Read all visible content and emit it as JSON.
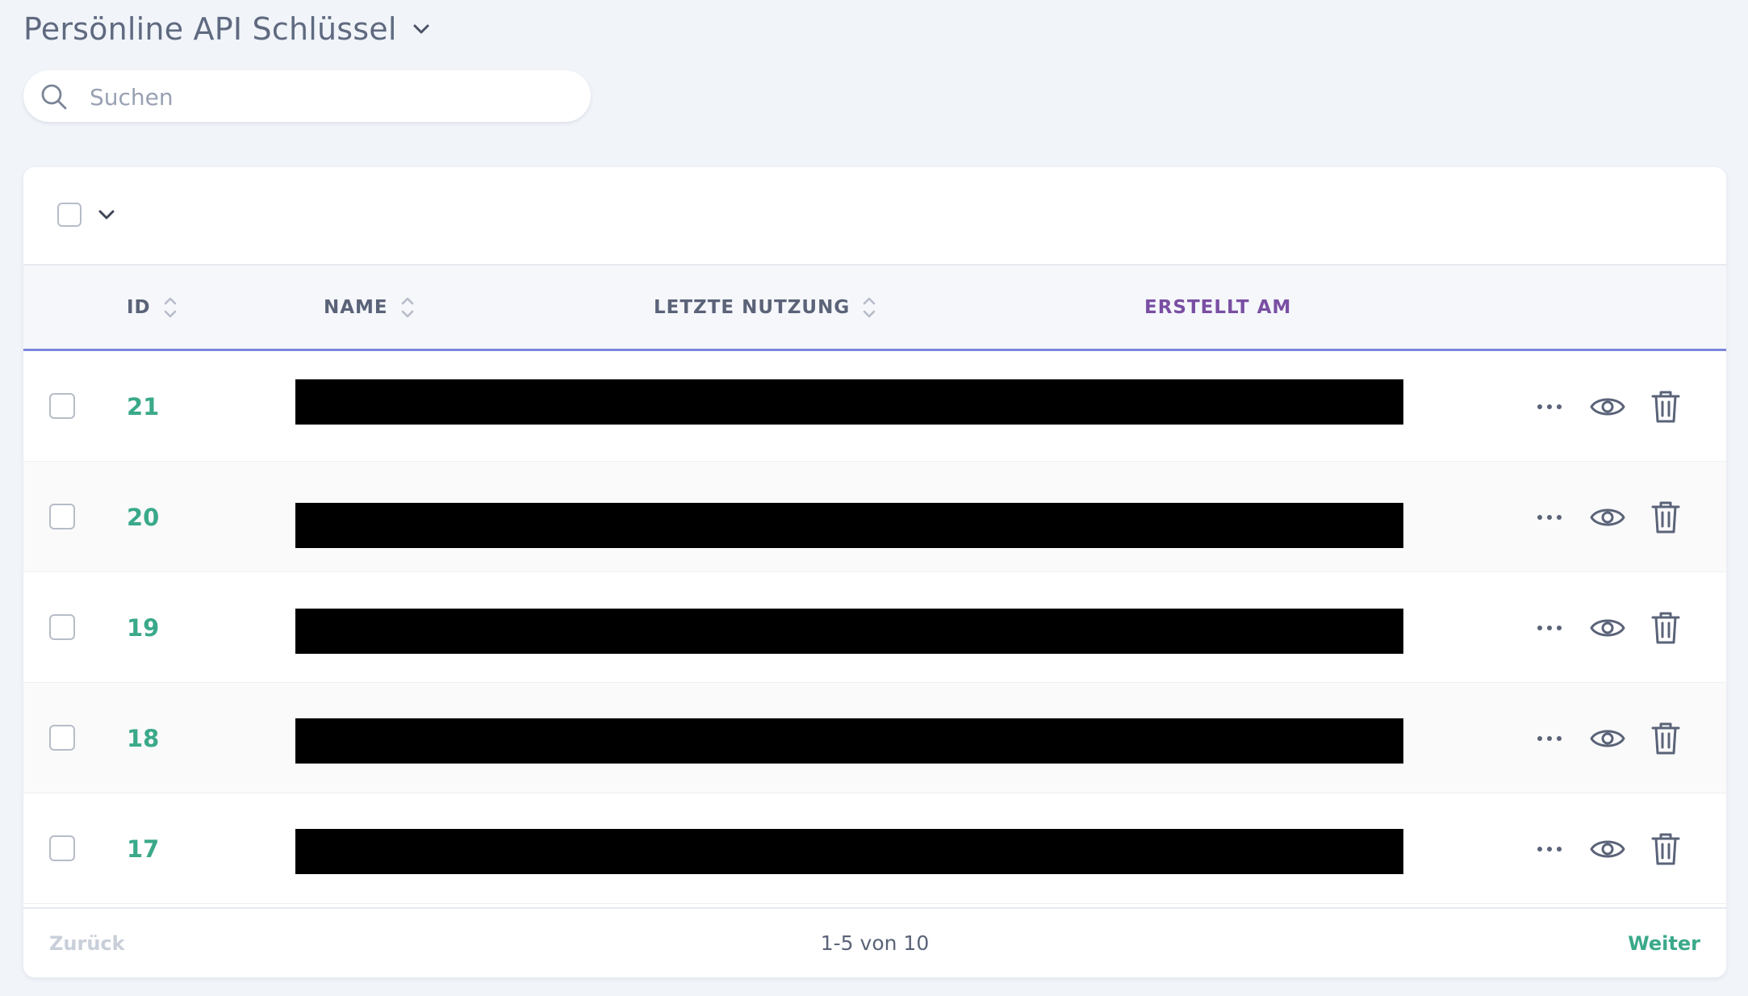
{
  "page": {
    "title": "Persönline API Schlüssel"
  },
  "search": {
    "placeholder": "Suchen",
    "value": ""
  },
  "table": {
    "columns": [
      {
        "label": "ID",
        "sortable": true
      },
      {
        "label": "NAME",
        "sortable": true
      },
      {
        "label": "LETZTE NUTZUNG",
        "sortable": true
      },
      {
        "label": "ERSTELLT AM",
        "sortable": false
      }
    ],
    "rows": [
      {
        "id": "21",
        "name_redacted": true
      },
      {
        "id": "20",
        "name_redacted": true
      },
      {
        "id": "19",
        "name_redacted": true
      },
      {
        "id": "18",
        "name_redacted": true
      },
      {
        "id": "17",
        "name_redacted": true
      }
    ],
    "row_actions": [
      "more-icon",
      "eye-icon",
      "trash-icon"
    ]
  },
  "pagination": {
    "prev_label": "Zurück",
    "info": "1-5 von 10",
    "next_label": "Weiter"
  },
  "colors": {
    "accent_green": "#3aa98a",
    "header_underline": "#7b86dd",
    "sorted_column": "#7a4fa3",
    "background": "#f1f4f9"
  }
}
